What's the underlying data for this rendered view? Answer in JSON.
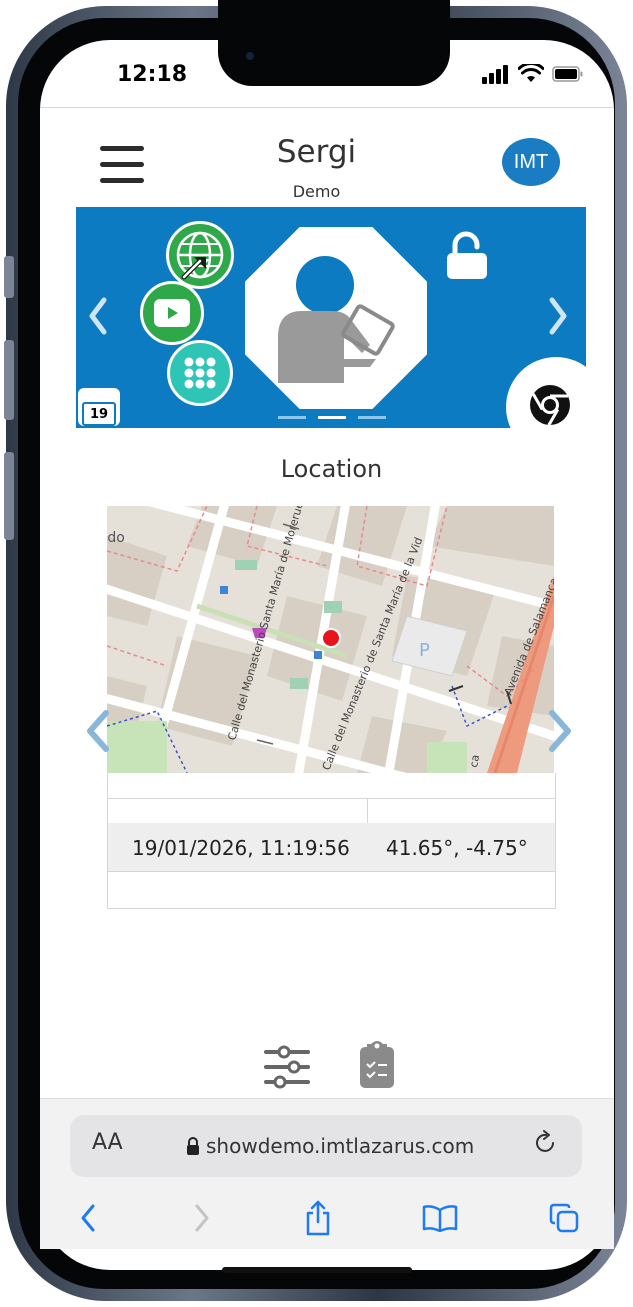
{
  "status_bar": {
    "time": "12:18"
  },
  "header": {
    "title": "Sergi",
    "subtitle": "Demo",
    "avatar_text": "IMT"
  },
  "banner": {
    "date_badge": "19",
    "carousel_pages": 3,
    "active_page": 2
  },
  "location": {
    "title": "Location",
    "map_labels": {
      "place_fragment": "rado",
      "street_1": "Calle del Monasterio Santa María de Moreruela",
      "street_2": "Calle del Monasterio de Santa María de la Vid",
      "avenue": "Avenida de Salamanca",
      "avenue_fragment": "ca",
      "parking": "P"
    },
    "rows": [
      {
        "timestamp": "19/01/2026, 11:19:56",
        "coordinates": "41.65°, -4.75°"
      }
    ]
  },
  "browser": {
    "text_size_label": "AA",
    "url": "showdemo.imtlazarus.com"
  },
  "colors": {
    "brand_blue": "#0d7bc1",
    "avatar_blue": "#1a7dc4",
    "map_marker": "#e8141b",
    "ios_blue": "#1d7bf3"
  }
}
